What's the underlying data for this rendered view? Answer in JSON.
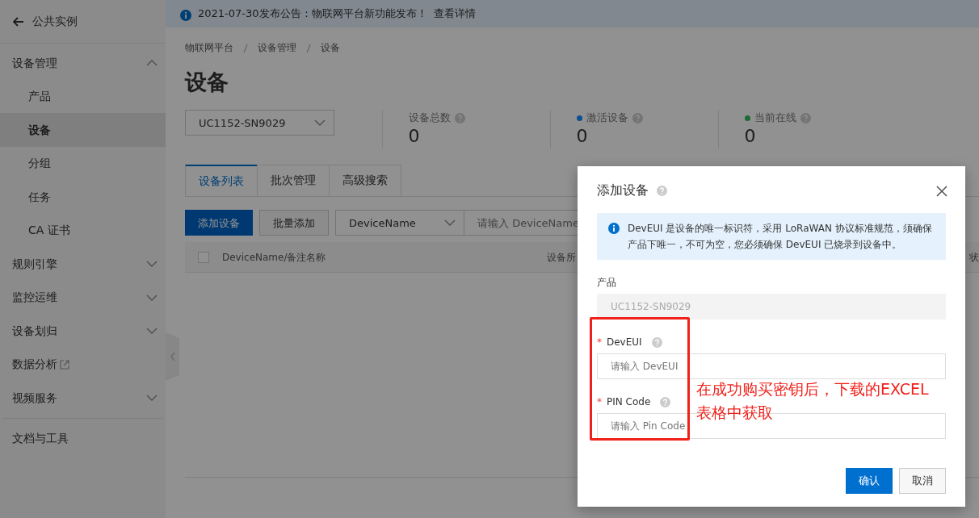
{
  "back": {
    "label": "公共实例"
  },
  "sidebar": {
    "items": [
      {
        "label": "设备管理",
        "kind": "group",
        "expanded": true,
        "children": [
          {
            "label": "产品",
            "selected": false
          },
          {
            "label": "设备",
            "selected": true
          },
          {
            "label": "分组",
            "selected": false
          },
          {
            "label": "任务",
            "selected": false
          },
          {
            "label": "CA 证书",
            "selected": false
          }
        ]
      },
      {
        "label": "规则引擎",
        "kind": "group",
        "expanded": false
      },
      {
        "label": "监控运维",
        "kind": "group",
        "expanded": false
      },
      {
        "label": "设备划归",
        "kind": "group",
        "expanded": false
      },
      {
        "label": "数据分析",
        "kind": "external"
      },
      {
        "label": "视频服务",
        "kind": "group",
        "expanded": false
      },
      {
        "label": "文档与工具",
        "kind": "link"
      }
    ]
  },
  "notice": {
    "text": "2021-07-30发布公告：物联网平台新功能发布！",
    "link": "查看详情"
  },
  "breadcrumb": [
    "物联网平台",
    "设备管理",
    "设备"
  ],
  "page_title": "设备",
  "product_select": {
    "value": "UC1152-SN9029"
  },
  "stats": [
    {
      "label": "设备总数",
      "value": "0"
    },
    {
      "label": "激活设备",
      "value": "0",
      "color": "#0a4f8f"
    },
    {
      "label": "当前在线",
      "value": "0",
      "color": "#1b6b33"
    }
  ],
  "tabs": [
    {
      "label": "设备列表",
      "selected": true
    },
    {
      "label": "批次管理",
      "selected": false
    },
    {
      "label": "高级搜索",
      "selected": false
    }
  ],
  "toolbar": {
    "add_button": "添加设备",
    "batch_button": "批量添加",
    "field_select": "DeviceName",
    "search": {
      "placeholder": "请输入 DeviceName"
    }
  },
  "table": {
    "select_all": {
      "checked": false
    },
    "columns": [
      "DeviceName/备注名称",
      "设备所",
      "状"
    ]
  },
  "dialog": {
    "title": "添加设备",
    "alert": "DevEUI 是设备的唯一标识符，采用 LoRaWAN 协议标准规范，须确保产品下唯一，不可为空，您必须确保 DevEUI 已烧录到设备中。",
    "fields": [
      {
        "label": "产品",
        "value": "UC1152-SN9029",
        "disabled": true
      },
      {
        "label": "DevEUI",
        "required_mark": "*",
        "help": true,
        "placeholder": "请输入 DevEUI"
      },
      {
        "label": "PIN Code",
        "required_mark": "*",
        "help": true,
        "placeholder": "请输入 Pin Code"
      }
    ],
    "buttons": [
      {
        "label": "确认",
        "kind": "primary"
      },
      {
        "label": "取消",
        "kind": "secondary"
      }
    ]
  },
  "annotation": {
    "text": "在成功购买密钥后，下载的EXCEL表格中获取"
  }
}
